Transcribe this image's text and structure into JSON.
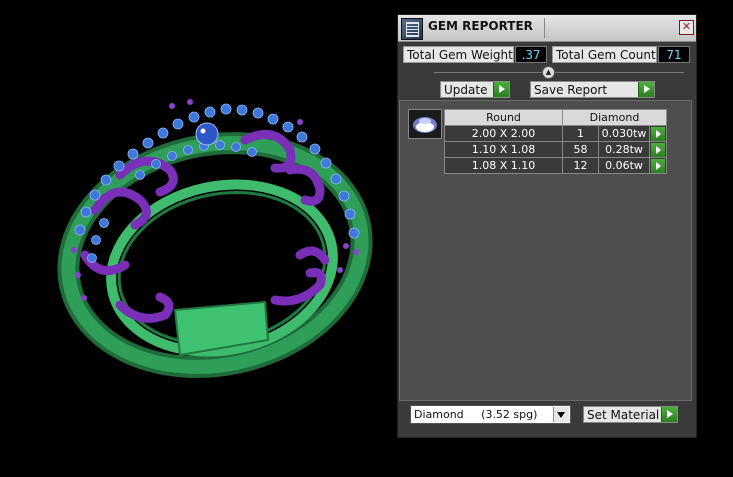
{
  "panel": {
    "title": "GEM REPORTER",
    "total_weight_label": "Total Gem Weight",
    "total_weight_value": ".37",
    "total_count_label": "Total Gem Count",
    "total_count_value": "71",
    "update_label": "Update",
    "save_label": "Save Report",
    "table": {
      "shape_header": "Round",
      "material_header": "Diamond",
      "rows": [
        {
          "size": "2.00 X 2.00",
          "count": "1",
          "weight": "0.030tw"
        },
        {
          "size": "1.10 X 1.08",
          "count": "58",
          "weight": "0.28tw"
        },
        {
          "size": "1.08 X 1.10",
          "count": "12",
          "weight": "0.06tw"
        }
      ]
    },
    "material_select": "Diamond     (3.52 spg)",
    "set_material_label": "Set Material"
  },
  "colors": {
    "band": "#2e9e58",
    "filigree": "#7a2fb8",
    "gems": "#3e78d8",
    "value_text": "#6fd7ff"
  }
}
